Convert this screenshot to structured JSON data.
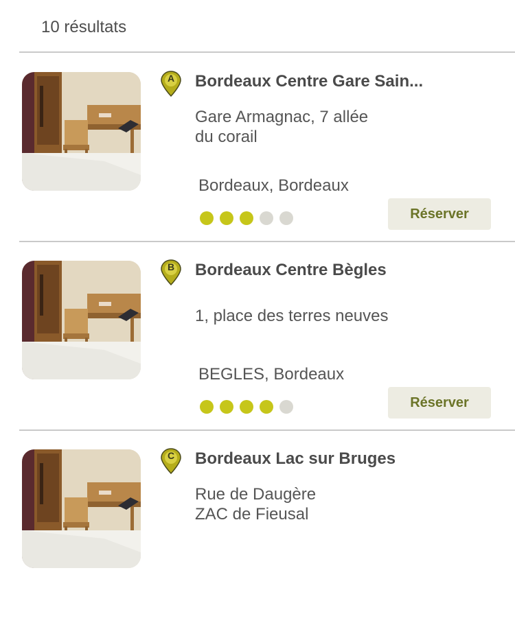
{
  "header": {
    "results_count": "10 résultats"
  },
  "hotels": [
    {
      "marker": "A",
      "name": "Bordeaux Centre Gare Sain...",
      "address_lines": [
        "Gare Armagnac, 7 allée",
        "du corail"
      ],
      "city": "Bordeaux, Bordeaux",
      "rating": 3,
      "rating_max": 5,
      "reserve_label": "Réserver"
    },
    {
      "marker": "B",
      "name": "Bordeaux Centre Bègles",
      "address_lines": [
        "1, place des terres neuves"
      ],
      "city": "BEGLES, Bordeaux",
      "rating": 4,
      "rating_max": 5,
      "reserve_label": "Réserver"
    },
    {
      "marker": "C",
      "name": "Bordeaux Lac sur Bruges",
      "address_lines": [
        "Rue de Daugère",
        "ZAC de Fieusal"
      ],
      "city": "",
      "rating": null,
      "rating_max": 5,
      "reserve_label": ""
    }
  ],
  "colors": {
    "accent": "#c6c61a",
    "rating_off": "#d9d8d1",
    "button_bg": "#edece2",
    "button_text": "#6b7428",
    "divider": "#c9c9c9",
    "marker": "#b5ad1b"
  },
  "icons": {
    "marker": "map-pin-icon",
    "thumbnail": "hotel-room-photo"
  }
}
